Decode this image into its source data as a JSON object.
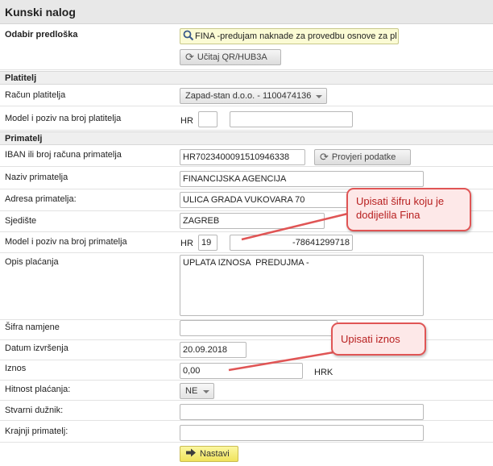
{
  "page_title": "Kunski nalog",
  "template": {
    "label": "Odabir predloška",
    "search_value": "FINA -predujam naknade za provedbu osnove za pl",
    "load_button": "Učitaj QR/HUB3A"
  },
  "payer": {
    "section": "Platitelj",
    "account_label": "Račun platitelja",
    "account_value": "Zapad-stan d.o.o. - 1100474136",
    "model_label": "Model i poziv na broj platitelja",
    "model_prefix": "HR",
    "model_value": "",
    "reference_value": ""
  },
  "recipient": {
    "section": "Primatelj",
    "iban_label": "IBAN ili broj računa primatelja",
    "iban_value": "HR7023400091510946338",
    "verify_button": "Provjeri podatke",
    "name_label": "Naziv primatelja",
    "name_value": "FINANCIJSKA AGENCIJA",
    "address_label": "Adresa primatelja:",
    "address_value": "ULICA GRADA VUKOVARA 70",
    "seat_label": "Sjedište",
    "seat_value": "ZAGREB",
    "model_label": "Model i poziv na broj primatelja",
    "model_prefix": "HR",
    "model_value": "19",
    "reference_value": "-78641299718"
  },
  "payment": {
    "description_label": "Opis plaćanja",
    "description_value": "UPLATA IZNOSA  PREDUJMA -",
    "purpose_label": "Šifra namjene",
    "purpose_value": "",
    "date_label": "Datum izvršenja",
    "date_value": "20.09.2018",
    "amount_label": "Iznos",
    "amount_value": "0,00",
    "currency": "HRK",
    "urgency_label": "Hitnost plaćanja:",
    "urgency_value": "NE",
    "debtor_label": "Stvarni dužnik:",
    "debtor_value": "",
    "final_recipient_label": "Krajnji primatelj:",
    "final_recipient_value": "",
    "continue_button": "Nastavi"
  },
  "annotations": {
    "callout_1": "Upisati šifru koju je dodijelila Fina",
    "callout_2": "Upisati iznos",
    "color": "#e05555"
  },
  "icons": {
    "search": "search-icon",
    "refresh": "refresh-icon",
    "next": "arrow-right-icon"
  }
}
